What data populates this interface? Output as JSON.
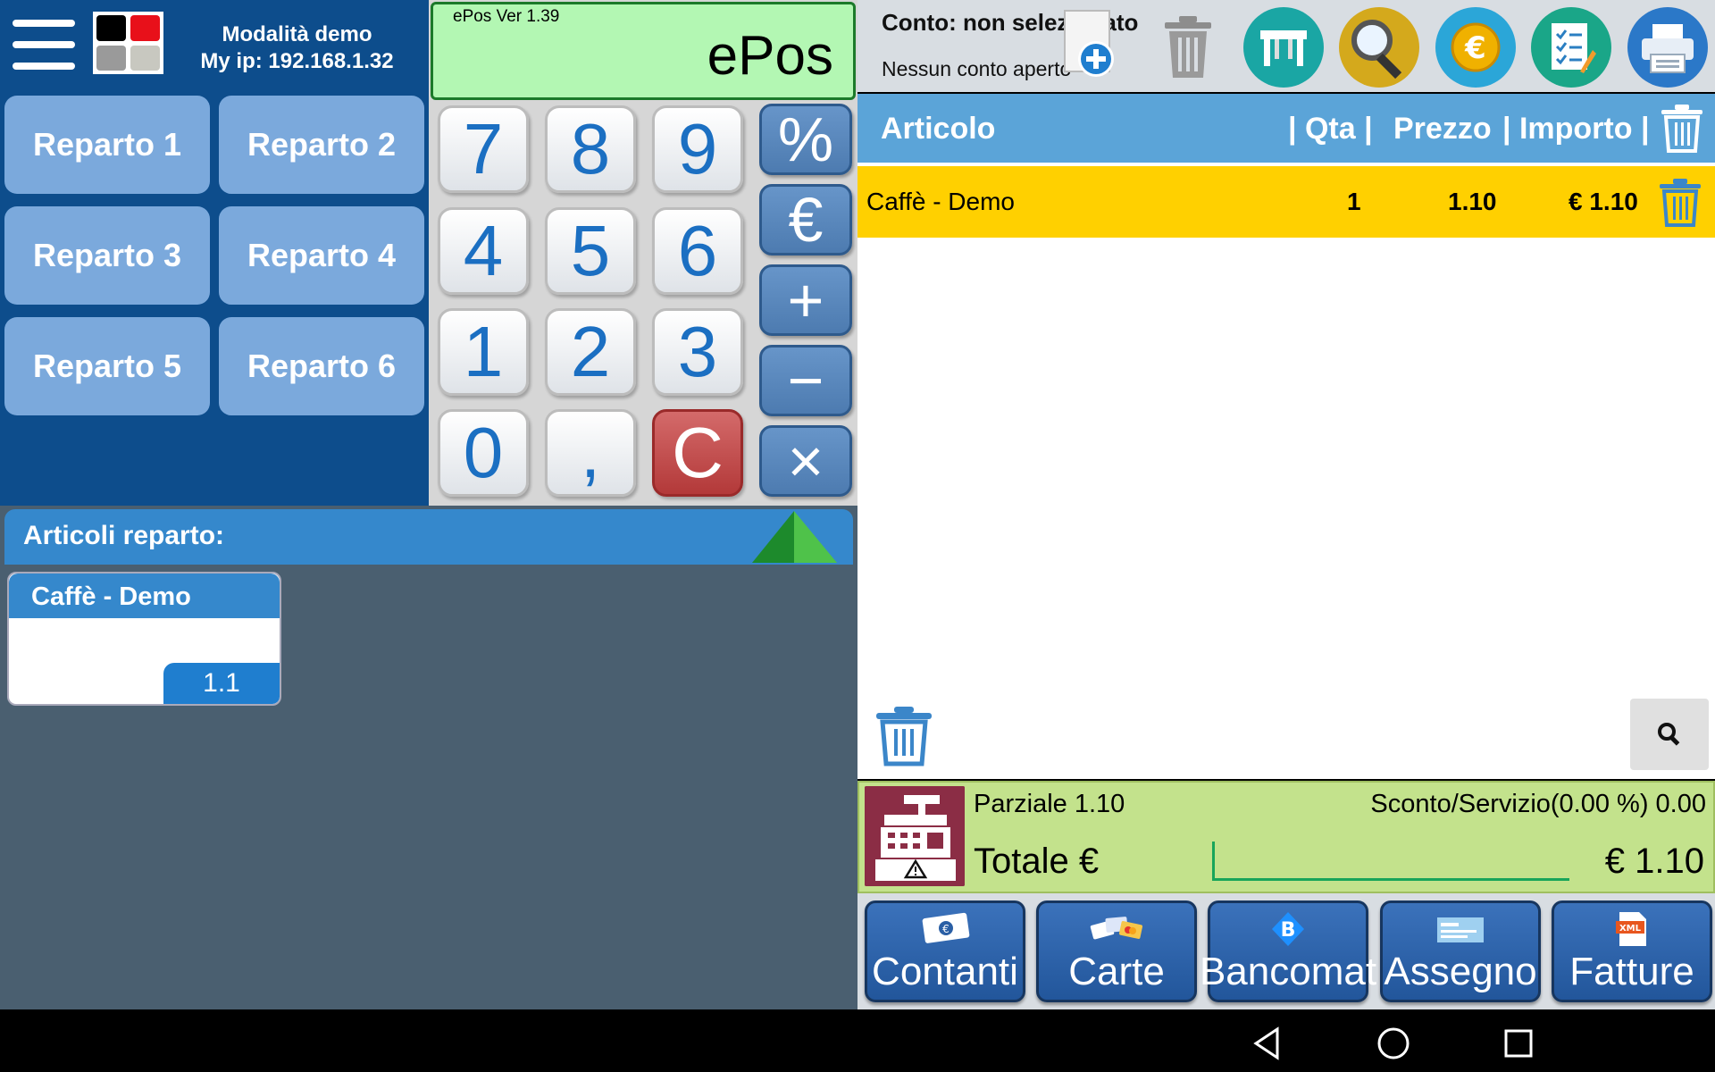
{
  "header": {
    "mode": "Modalità demo",
    "ip": "My ip: 192.168.1.32",
    "logo_colors": [
      "#000000",
      "#e8101a",
      "#9a9a9a",
      "#c8c8c0"
    ]
  },
  "departments": [
    "Reparto 1",
    "Reparto 2",
    "Reparto 3",
    "Reparto 4",
    "Reparto 5",
    "Reparto 6"
  ],
  "display": {
    "version": "ePos Ver 1.39",
    "value": "ePos"
  },
  "keypad": {
    "digits": [
      "7",
      "8",
      "9",
      "4",
      "5",
      "6",
      "1",
      "2",
      "3",
      "0",
      ",",
      "C"
    ],
    "operators": [
      "%",
      "€",
      "+",
      "−",
      "×"
    ]
  },
  "articles": {
    "title": "Articoli reparto:",
    "items": [
      {
        "name": "Caffè - Demo",
        "price": "1.1"
      }
    ]
  },
  "account": {
    "title": "Conto: non selezionato",
    "subtitle": "Nessun conto aperto"
  },
  "table": {
    "headers": {
      "article": "Articolo",
      "qty": "| Qta |",
      "price": "Prezzo",
      "amount": "| Importo |"
    },
    "rows": [
      {
        "name": "Caffè - Demo",
        "qty": "1",
        "price": "1.10",
        "amount": "€ 1.10"
      }
    ]
  },
  "totals": {
    "partial": "Parziale 1.10",
    "discount": "Sconto/Servizio(0.00 %) 0.00",
    "total_label": "Totale €",
    "total_value": "€ 1.10"
  },
  "payments": [
    "Contanti",
    "Carte",
    "Bancomat",
    "Assegno",
    "Fatture"
  ],
  "icons": {
    "menu": "hamburger-menu-icon",
    "tables": "table-icon",
    "search": "magnifier-icon",
    "euro": "euro-coin-icon",
    "notes": "checklist-icon",
    "print": "printer-icon"
  },
  "colors": {
    "dark_blue": "#0d4d8c",
    "display_green": "#b3f7b3",
    "row_highlight": "#ffd000",
    "totals_green": "#c3e28c",
    "header_blue": "#5ba4d8"
  }
}
